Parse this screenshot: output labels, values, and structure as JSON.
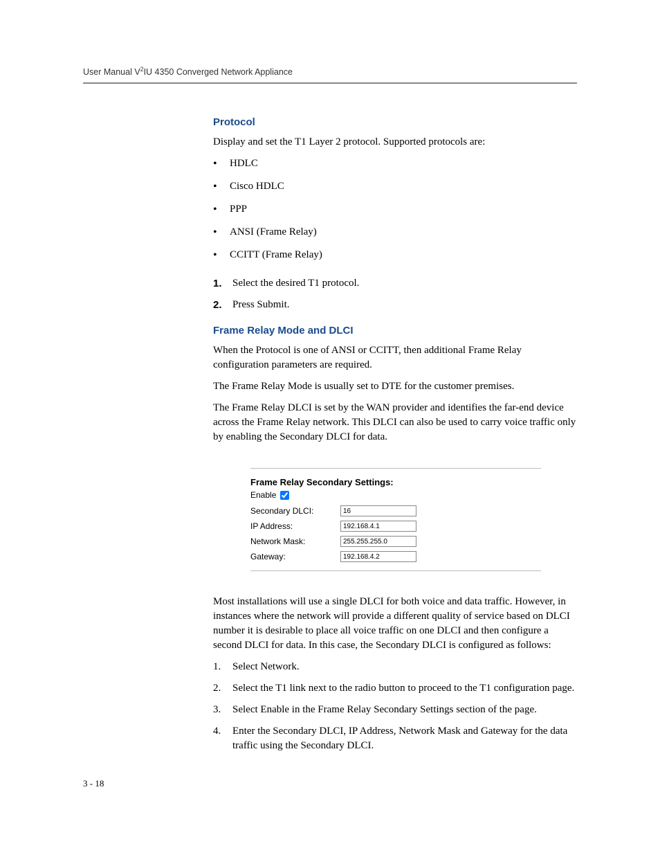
{
  "header": {
    "text_prefix": "User Manual V",
    "text_super": "2",
    "text_suffix": "IU 4350 Converged Network Appliance"
  },
  "protocol": {
    "heading": "Protocol",
    "intro": "Display and set the T1 Layer 2 protocol. Supported protocols are:",
    "bullets": [
      "HDLC",
      "Cisco HDLC",
      "PPP",
      "ANSI (Frame Relay)",
      "CCITT (Frame Relay)"
    ],
    "steps": [
      {
        "num": "1.",
        "text": "Select the desired T1 protocol."
      },
      {
        "num": "2.",
        "text": "Press Submit."
      }
    ]
  },
  "frame_relay": {
    "heading": "Frame Relay Mode and DLCI",
    "para1": "When the Protocol is one of ANSI or CCITT, then additional Frame Relay configuration parameters are required.",
    "para2": "The Frame Relay Mode is usually set to DTE for the customer premises.",
    "para3": "The Frame Relay DLCI is set by the WAN provider and identifies the far-end device across the Frame Relay network. This DLCI can also be used to carry voice traffic only by enabling the Secondary DLCI for data."
  },
  "figure": {
    "title": "Frame Relay Secondary Settings:",
    "enable_label": "Enable",
    "enable_checked": true,
    "rows": [
      {
        "label": "Secondary DLCI:",
        "value": "16"
      },
      {
        "label": "IP Address:",
        "value": "192.168.4.1"
      },
      {
        "label": "Network Mask:",
        "value": "255.255.255.0"
      },
      {
        "label": "Gateway:",
        "value": "192.168.4.2"
      }
    ]
  },
  "dlci_config": {
    "para1": "Most installations will use a single DLCI for both voice and data traffic. However, in instances where the network will provide a different quality of service based on DLCI number it is desirable to place all voice traffic on one DLCI and then configure a second DLCI for data. In this case, the Secondary DLCI is configured as follows:",
    "steps": [
      {
        "num": "1.",
        "text": "Select Network."
      },
      {
        "num": "2.",
        "text": "Select the T1 link next to the radio button to proceed to the T1 configuration page."
      },
      {
        "num": "3.",
        "text": "Select Enable in the Frame Relay Secondary Settings section of the page."
      },
      {
        "num": "4.",
        "text": "Enter the Secondary DLCI, IP Address, Network Mask and Gateway for the data traffic using the Secondary DLCI."
      }
    ]
  },
  "page_number": "3 - 18"
}
